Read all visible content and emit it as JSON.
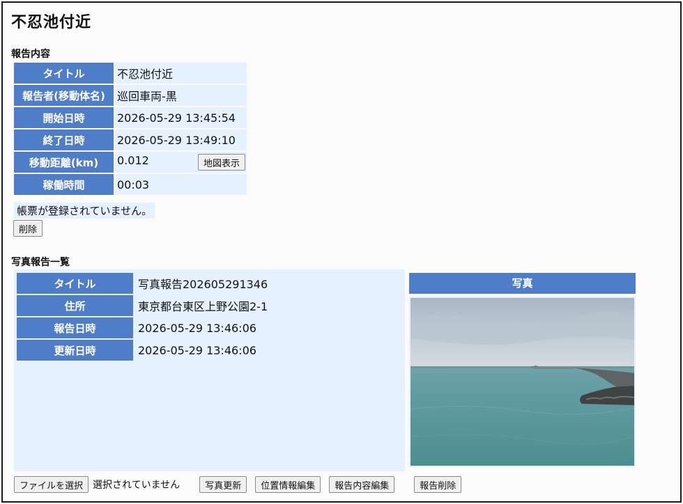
{
  "page": {
    "title": "不忍池付近"
  },
  "report": {
    "heading": "報告内容",
    "rows": [
      {
        "label": "タイトル",
        "value": "不忍池付近"
      },
      {
        "label": "報告者(移動体名)",
        "value": "巡回車両-黒"
      },
      {
        "label": "開始日時",
        "value": "2026-05-29 13:45:54"
      },
      {
        "label": "終了日時",
        "value": "2026-05-29 13:49:10"
      },
      {
        "label": "移動距離(km)",
        "value": "0.012"
      },
      {
        "label": "稼働時間",
        "value": "00:03"
      }
    ],
    "map_button": "地図表示",
    "no_forms": "帳票が登録されていません。",
    "delete_button": "削除"
  },
  "photos": {
    "heading": "写真報告一覧",
    "rows": [
      {
        "label": "タイトル",
        "value": "写真報告202605291346"
      },
      {
        "label": "住所",
        "value": "東京都台東区上野公園2-1"
      },
      {
        "label": "報告日時",
        "value": "2026-05-29 13:46:06"
      },
      {
        "label": "更新日時",
        "value": "2026-05-29 13:46:06"
      }
    ],
    "photo_header": "写真",
    "file_button": "ファイルを選択",
    "file_status": "選択されていません",
    "update_photo": "写真更新",
    "edit_location": "位置情報編集",
    "edit_content": "報告内容編集",
    "delete_report": "報告削除"
  },
  "colors": {
    "header_bg": "#4f7dc8",
    "value_bg": "#e6f1ff"
  }
}
